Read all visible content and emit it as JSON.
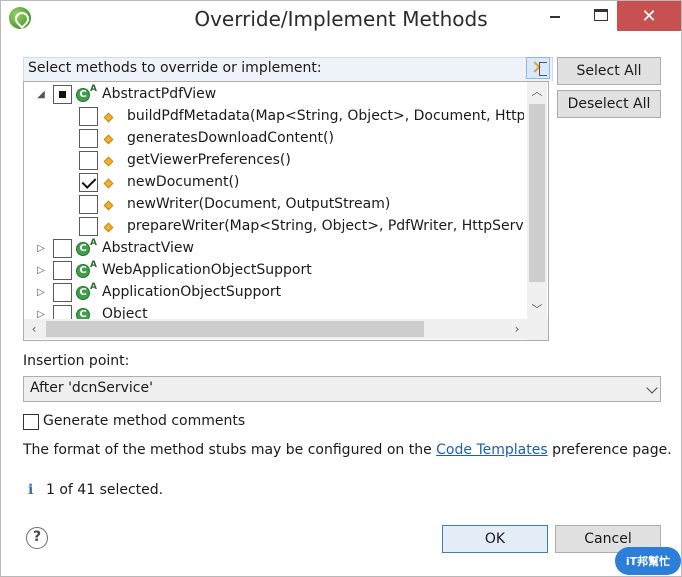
{
  "window": {
    "title": "Override/Implement Methods",
    "close_glyph": "✕"
  },
  "methods_panel": {
    "label": "Select methods to override or implement:",
    "tree": [
      {
        "kind": "class",
        "label": "AbstractPdfView",
        "expanded": true,
        "state": "partial",
        "icon": "class-icon-abstract"
      },
      {
        "kind": "method",
        "label": "buildPdfMetadata(Map<String, Object>, Document, HttpS",
        "state": "unchecked",
        "icon": "protected-method-icon"
      },
      {
        "kind": "method",
        "label": "generatesDownloadContent()",
        "state": "unchecked",
        "icon": "protected-method-icon"
      },
      {
        "kind": "method",
        "label": "getViewerPreferences()",
        "state": "unchecked",
        "icon": "protected-method-icon"
      },
      {
        "kind": "method",
        "label": "newDocument()",
        "state": "checked",
        "icon": "protected-method-icon"
      },
      {
        "kind": "method",
        "label": "newWriter(Document, OutputStream)",
        "state": "unchecked",
        "icon": "protected-method-icon"
      },
      {
        "kind": "method",
        "label": "prepareWriter(Map<String, Object>, PdfWriter, HttpServl",
        "state": "unchecked",
        "icon": "protected-method-icon"
      },
      {
        "kind": "class",
        "label": "AbstractView",
        "expanded": false,
        "state": "unchecked",
        "icon": "class-icon-abstract"
      },
      {
        "kind": "class",
        "label": "WebApplicationObjectSupport",
        "expanded": false,
        "state": "unchecked",
        "icon": "class-icon-abstract"
      },
      {
        "kind": "class",
        "label": "ApplicationObjectSupport",
        "expanded": false,
        "state": "unchecked",
        "icon": "class-icon-abstract"
      },
      {
        "kind": "class",
        "label": "Object",
        "expanded": false,
        "state": "unchecked",
        "icon": "class-icon"
      }
    ]
  },
  "buttons": {
    "select_all": "Select All",
    "deselect_all": "Deselect All",
    "ok": "OK",
    "cancel": "Cancel"
  },
  "insertion": {
    "label": "Insertion point:",
    "selected": "After 'dcnService'"
  },
  "generate_comments": {
    "label": "Generate method comments",
    "checked": false
  },
  "format_line": {
    "prefix": "The format of the method stubs may be configured on the ",
    "link": "Code Templates",
    "suffix": " preference page."
  },
  "status": {
    "text": "1 of 41 selected."
  },
  "watermark": {
    "text": "iT邦幫忙"
  }
}
